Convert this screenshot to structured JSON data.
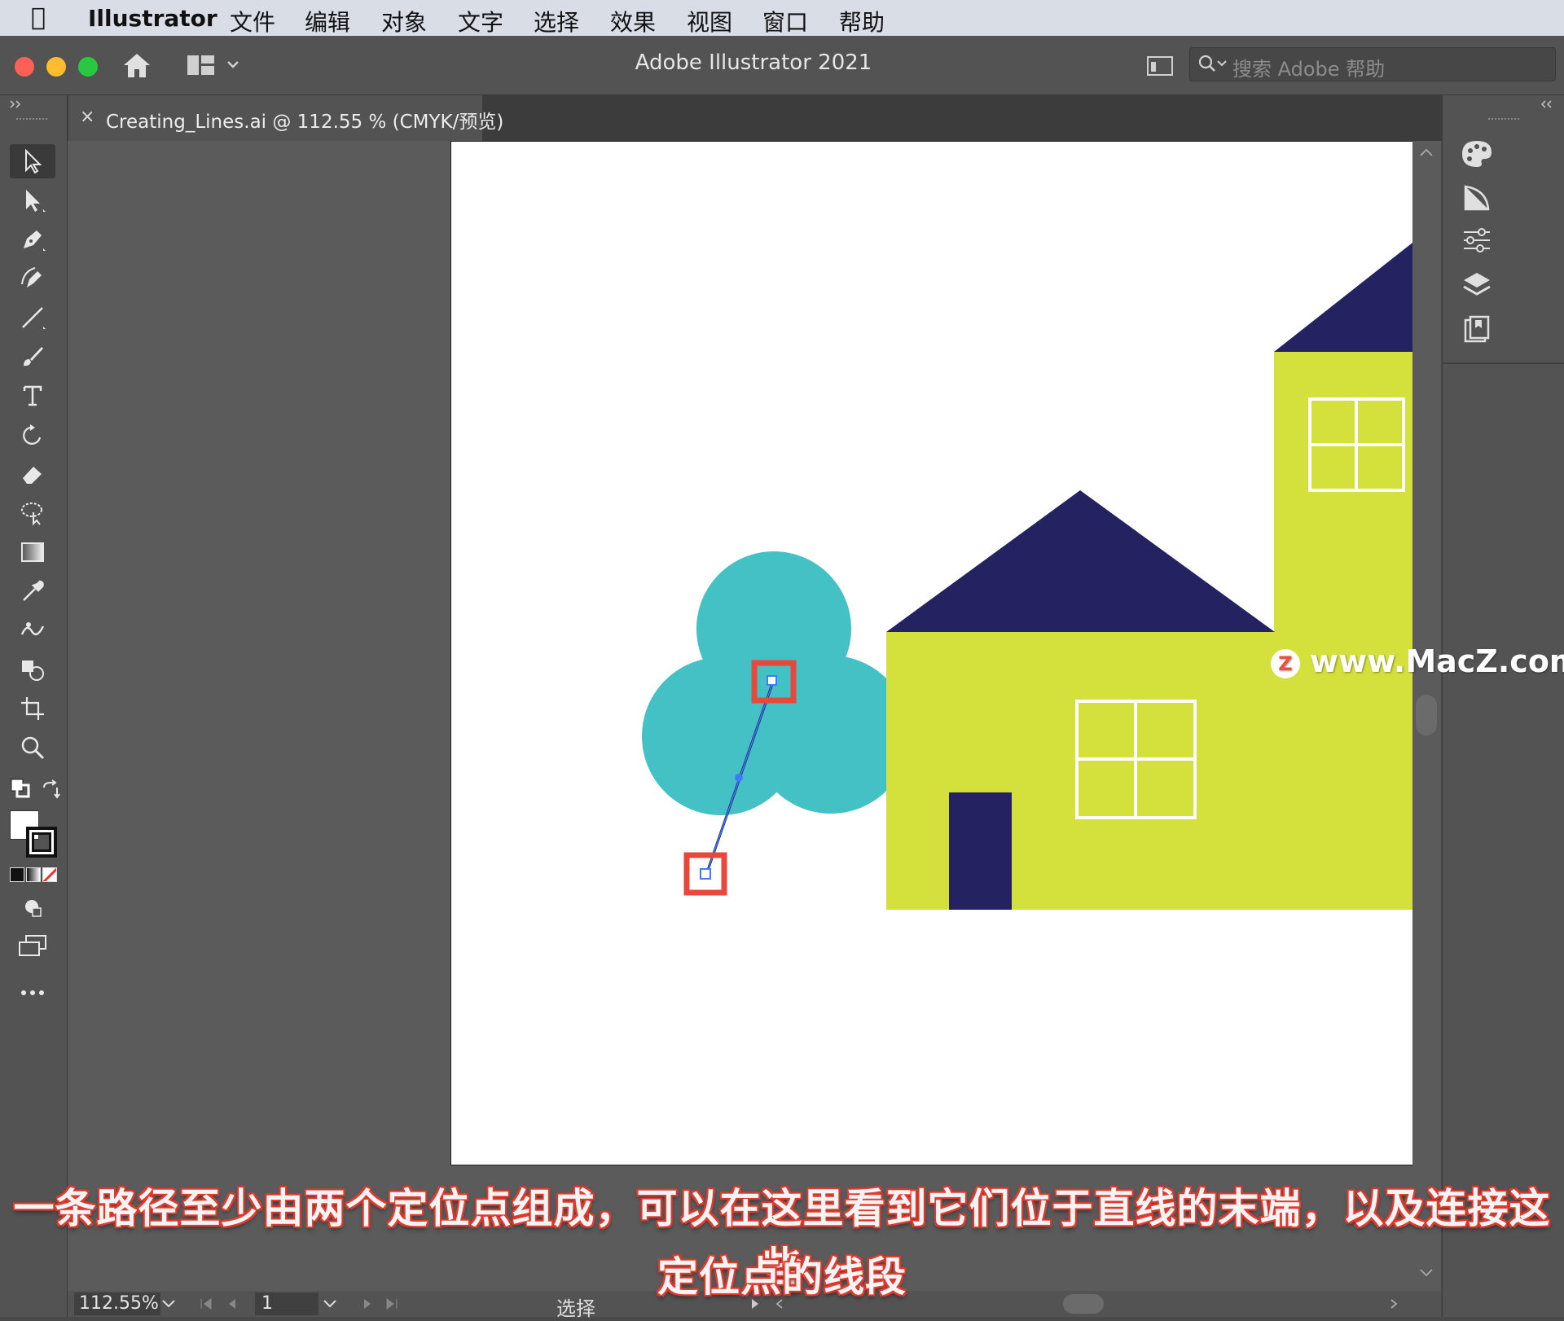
{
  "menubar": {
    "app_name": "Illustrator",
    "items": [
      "文件",
      "编辑",
      "对象",
      "文字",
      "选择",
      "效果",
      "视图",
      "窗口",
      "帮助"
    ]
  },
  "window": {
    "title": "Adobe Illustrator 2021",
    "search_placeholder": "搜索 Adobe 帮助"
  },
  "document_tab": {
    "close": "×",
    "title": "Creating_Lines.ai @ 112.55 % (CMYK/预览)"
  },
  "status_bar": {
    "zoom": "112.55%",
    "page": "1",
    "tool_label": "选择"
  },
  "caption": {
    "line1": "一条路径至少由两个定位点组成，可以在这里看到它们位于直线的末端，以及连接这些",
    "line2": "定位点的线段"
  },
  "watermark": {
    "badge": "Z",
    "text": "www.MacZ.com"
  },
  "colors": {
    "teal": "#43c1c5",
    "navy": "#252262",
    "lime": "#d4e03c",
    "highlight": "#e8473b",
    "selection": "#3d7bff"
  },
  "toolbar": {
    "tools": [
      "selection-tool-icon",
      "direct-selection-tool-icon",
      "pen-tool-icon",
      "curvature-tool-icon",
      "line-tool-icon",
      "paintbrush-tool-icon",
      "type-tool-icon",
      "rotate-tool-icon",
      "eraser-tool-icon",
      "lasso-tool-icon",
      "gradient-tool-icon",
      "eyedropper-tool-icon",
      "puppet-warp-tool-icon",
      "shape-builder-tool-icon",
      "artboard-tool-icon",
      "zoom-tool-icon"
    ]
  },
  "right_panel": {
    "icons": [
      "color-panel-icon",
      "color-guide-icon",
      "properties-icon",
      "layers-icon",
      "libraries-icon"
    ]
  }
}
